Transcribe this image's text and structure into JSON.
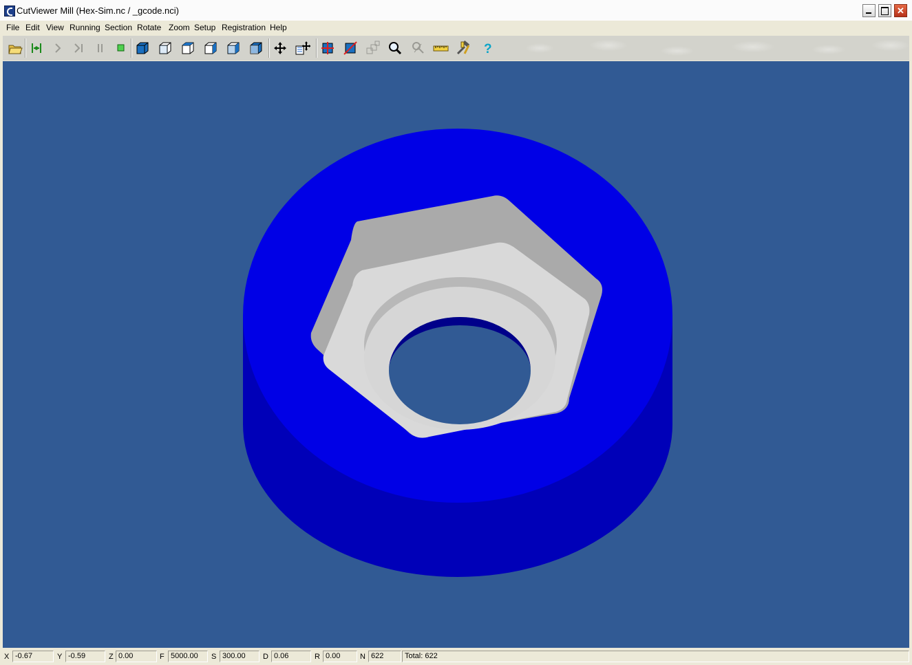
{
  "window": {
    "title": "CutViewer Mill (Hex-Sim.nc / _gcode.nci)",
    "controls": {
      "minimize": "",
      "maximize": "",
      "close": "✕"
    }
  },
  "menu": [
    "File",
    "Edit",
    "View",
    "Running",
    "Section",
    "Rotate",
    "Zoom",
    "Setup",
    "Registration",
    "Help"
  ],
  "toolbar": {
    "icons": [
      "open-folder-icon",
      "rewind-icon",
      "step-icon",
      "step-to-end-icon",
      "pause-icon",
      "stop-icon",
      "iso-view-icon",
      "front-view-icon",
      "top-view-icon",
      "side-view-icon",
      "right-view-icon",
      "back-view-icon",
      "pan-icon",
      "rotate-view-icon",
      "section-icon",
      "cut-section-icon",
      "multi-view-icon",
      "zoom-icon",
      "measure-icon",
      "ruler-icon",
      "tools-icon",
      "help-icon"
    ],
    "help_glyph": "?"
  },
  "viewport": {
    "background": "#315a94",
    "part_color": "#0000e6",
    "part_side_color": "#0000b8",
    "pocket_color": "#d9d9d9"
  },
  "status": {
    "x_label": "X",
    "x": "-0.67",
    "y_label": "Y",
    "y": "-0.59",
    "z_label": "Z",
    "z": "0.00",
    "f_label": "F",
    "f": "5000.00",
    "s_label": "S",
    "s": "300.00",
    "d_label": "D",
    "d": "0.06",
    "r_label": "R",
    "r": "0.00",
    "n_label": "N",
    "n": "622",
    "total": "Total: 622"
  }
}
